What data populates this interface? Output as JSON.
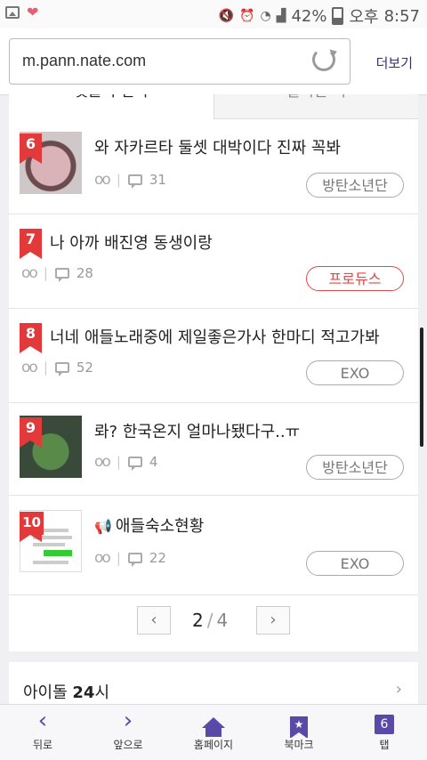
{
  "status": {
    "battery": "42%",
    "ampm": "오후",
    "time": "8:57"
  },
  "browser": {
    "url": "m.pann.nate.com",
    "more_label": "더보기"
  },
  "tabs": [
    {
      "label": "댓글의 진국"
    },
    {
      "label": "실시간 톡"
    }
  ],
  "items": [
    {
      "rank": "6",
      "title": "와 자카르타 둘셋 대박이다 진짜 꼭봐",
      "comments": "31",
      "tag": "방탄소년단"
    },
    {
      "rank": "7",
      "title": "나 아까 배진영 동생이랑",
      "comments": "28",
      "tag": "프로듀스"
    },
    {
      "rank": "8",
      "title": "너네 애들노래중에 제일좋은가사 한마디 적고가봐",
      "comments": "52",
      "tag": "EXO"
    },
    {
      "rank": "9",
      "title": "롸? 한국온지 얼마나됐다구..ㅠ",
      "comments": "4",
      "tag": "방탄소년단"
    },
    {
      "rank": "10",
      "title": "애들숙소현황",
      "comments": "22",
      "tag": "EXO"
    }
  ],
  "pager": {
    "current": "2",
    "total": "4"
  },
  "section2": {
    "title_bold": "24",
    "title_pre": "아이돌 ",
    "title_post": "시"
  },
  "nav": [
    {
      "label": "뒤로",
      "icon": "back-icon"
    },
    {
      "label": "앞으로",
      "icon": "forward-icon"
    },
    {
      "label": "홈페이지",
      "icon": "home-icon"
    },
    {
      "label": "북마크",
      "icon": "bookmark-icon"
    },
    {
      "label": "탭",
      "icon": "tabs-icon",
      "count": "6"
    }
  ],
  "colors": {
    "accent": "#5a4aa8",
    "rank": "#e23a3a",
    "tag_red": "#e24a4a"
  }
}
